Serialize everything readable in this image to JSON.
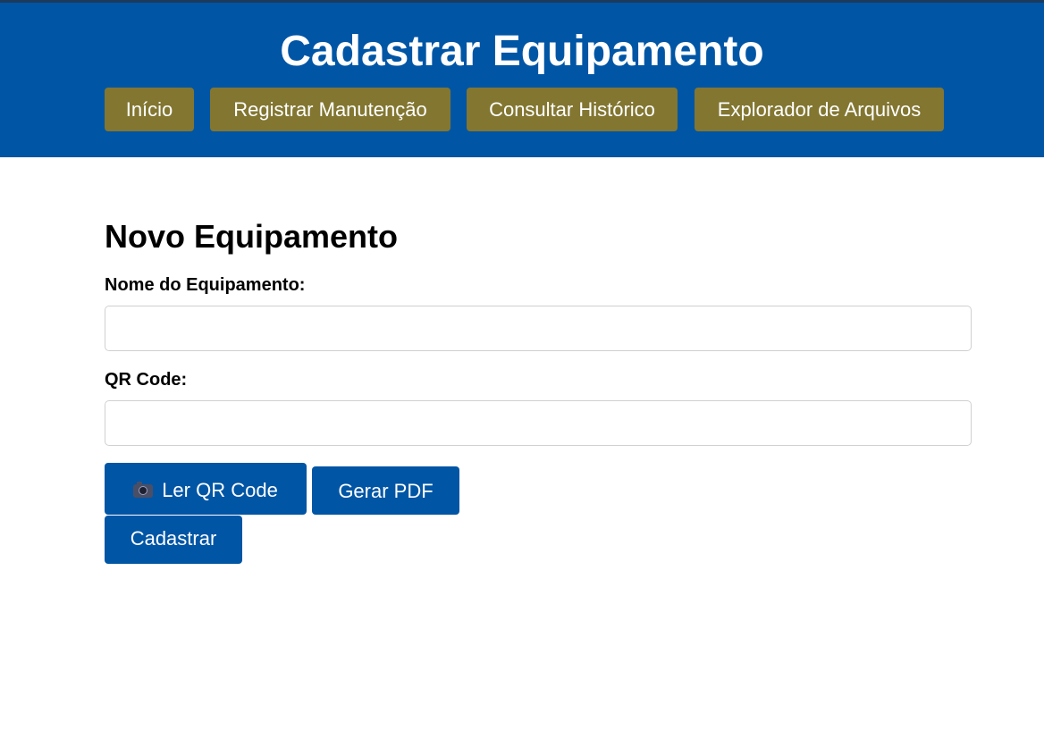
{
  "header": {
    "title": "Cadastrar Equipamento",
    "nav": [
      {
        "label": "Início"
      },
      {
        "label": "Registrar Manutenção"
      },
      {
        "label": "Consultar Histórico"
      },
      {
        "label": "Explorador de Arquivos"
      }
    ]
  },
  "form": {
    "heading": "Novo Equipamento",
    "name_label": "Nome do Equipamento:",
    "name_value": "",
    "qr_label": "QR Code:",
    "qr_value": "",
    "read_qr_label": "Ler QR Code",
    "read_qr_icon": "camera-icon",
    "pdf_label": "Gerar PDF",
    "submit_label": "Cadastrar"
  },
  "colors": {
    "header_bg": "#0055a5",
    "nav_button_bg": "#827631",
    "action_button_bg": "#0055a5"
  }
}
